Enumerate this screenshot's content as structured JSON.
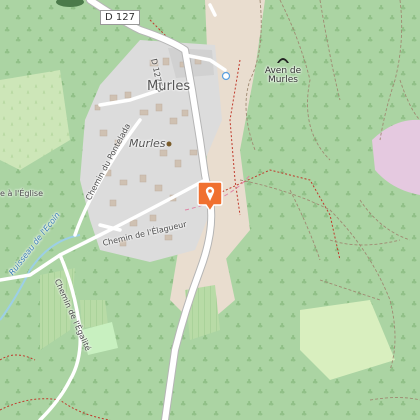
{
  "map": {
    "title": "Murles",
    "labels": {
      "road_d127": "D 127",
      "road_d127e3": "D 127E3",
      "village_main": "Murles",
      "village_secondary": "Murles",
      "cave_line1": "Aven de",
      "cave_line2": "Murles",
      "chemin_pontelada": "Chemin du Pontelada",
      "chemin_elagueur": "Chemin de l'Élagueur",
      "chemin_egalite": "Chemin de l'Égalité",
      "ruisseau": "Ruisseau de l'Ecoin",
      "edge_text": "e à l'Église"
    },
    "colors": {
      "forest": "#abd4a3",
      "residential": "#dcdcdc",
      "road": "#ffffff",
      "path": "#c0392b",
      "water": "#9ccfe6",
      "marker": "#f07030"
    },
    "icons": [
      "cave-icon",
      "location-pin-icon",
      "viewpoint-icon",
      "place-dot-icon"
    ]
  }
}
